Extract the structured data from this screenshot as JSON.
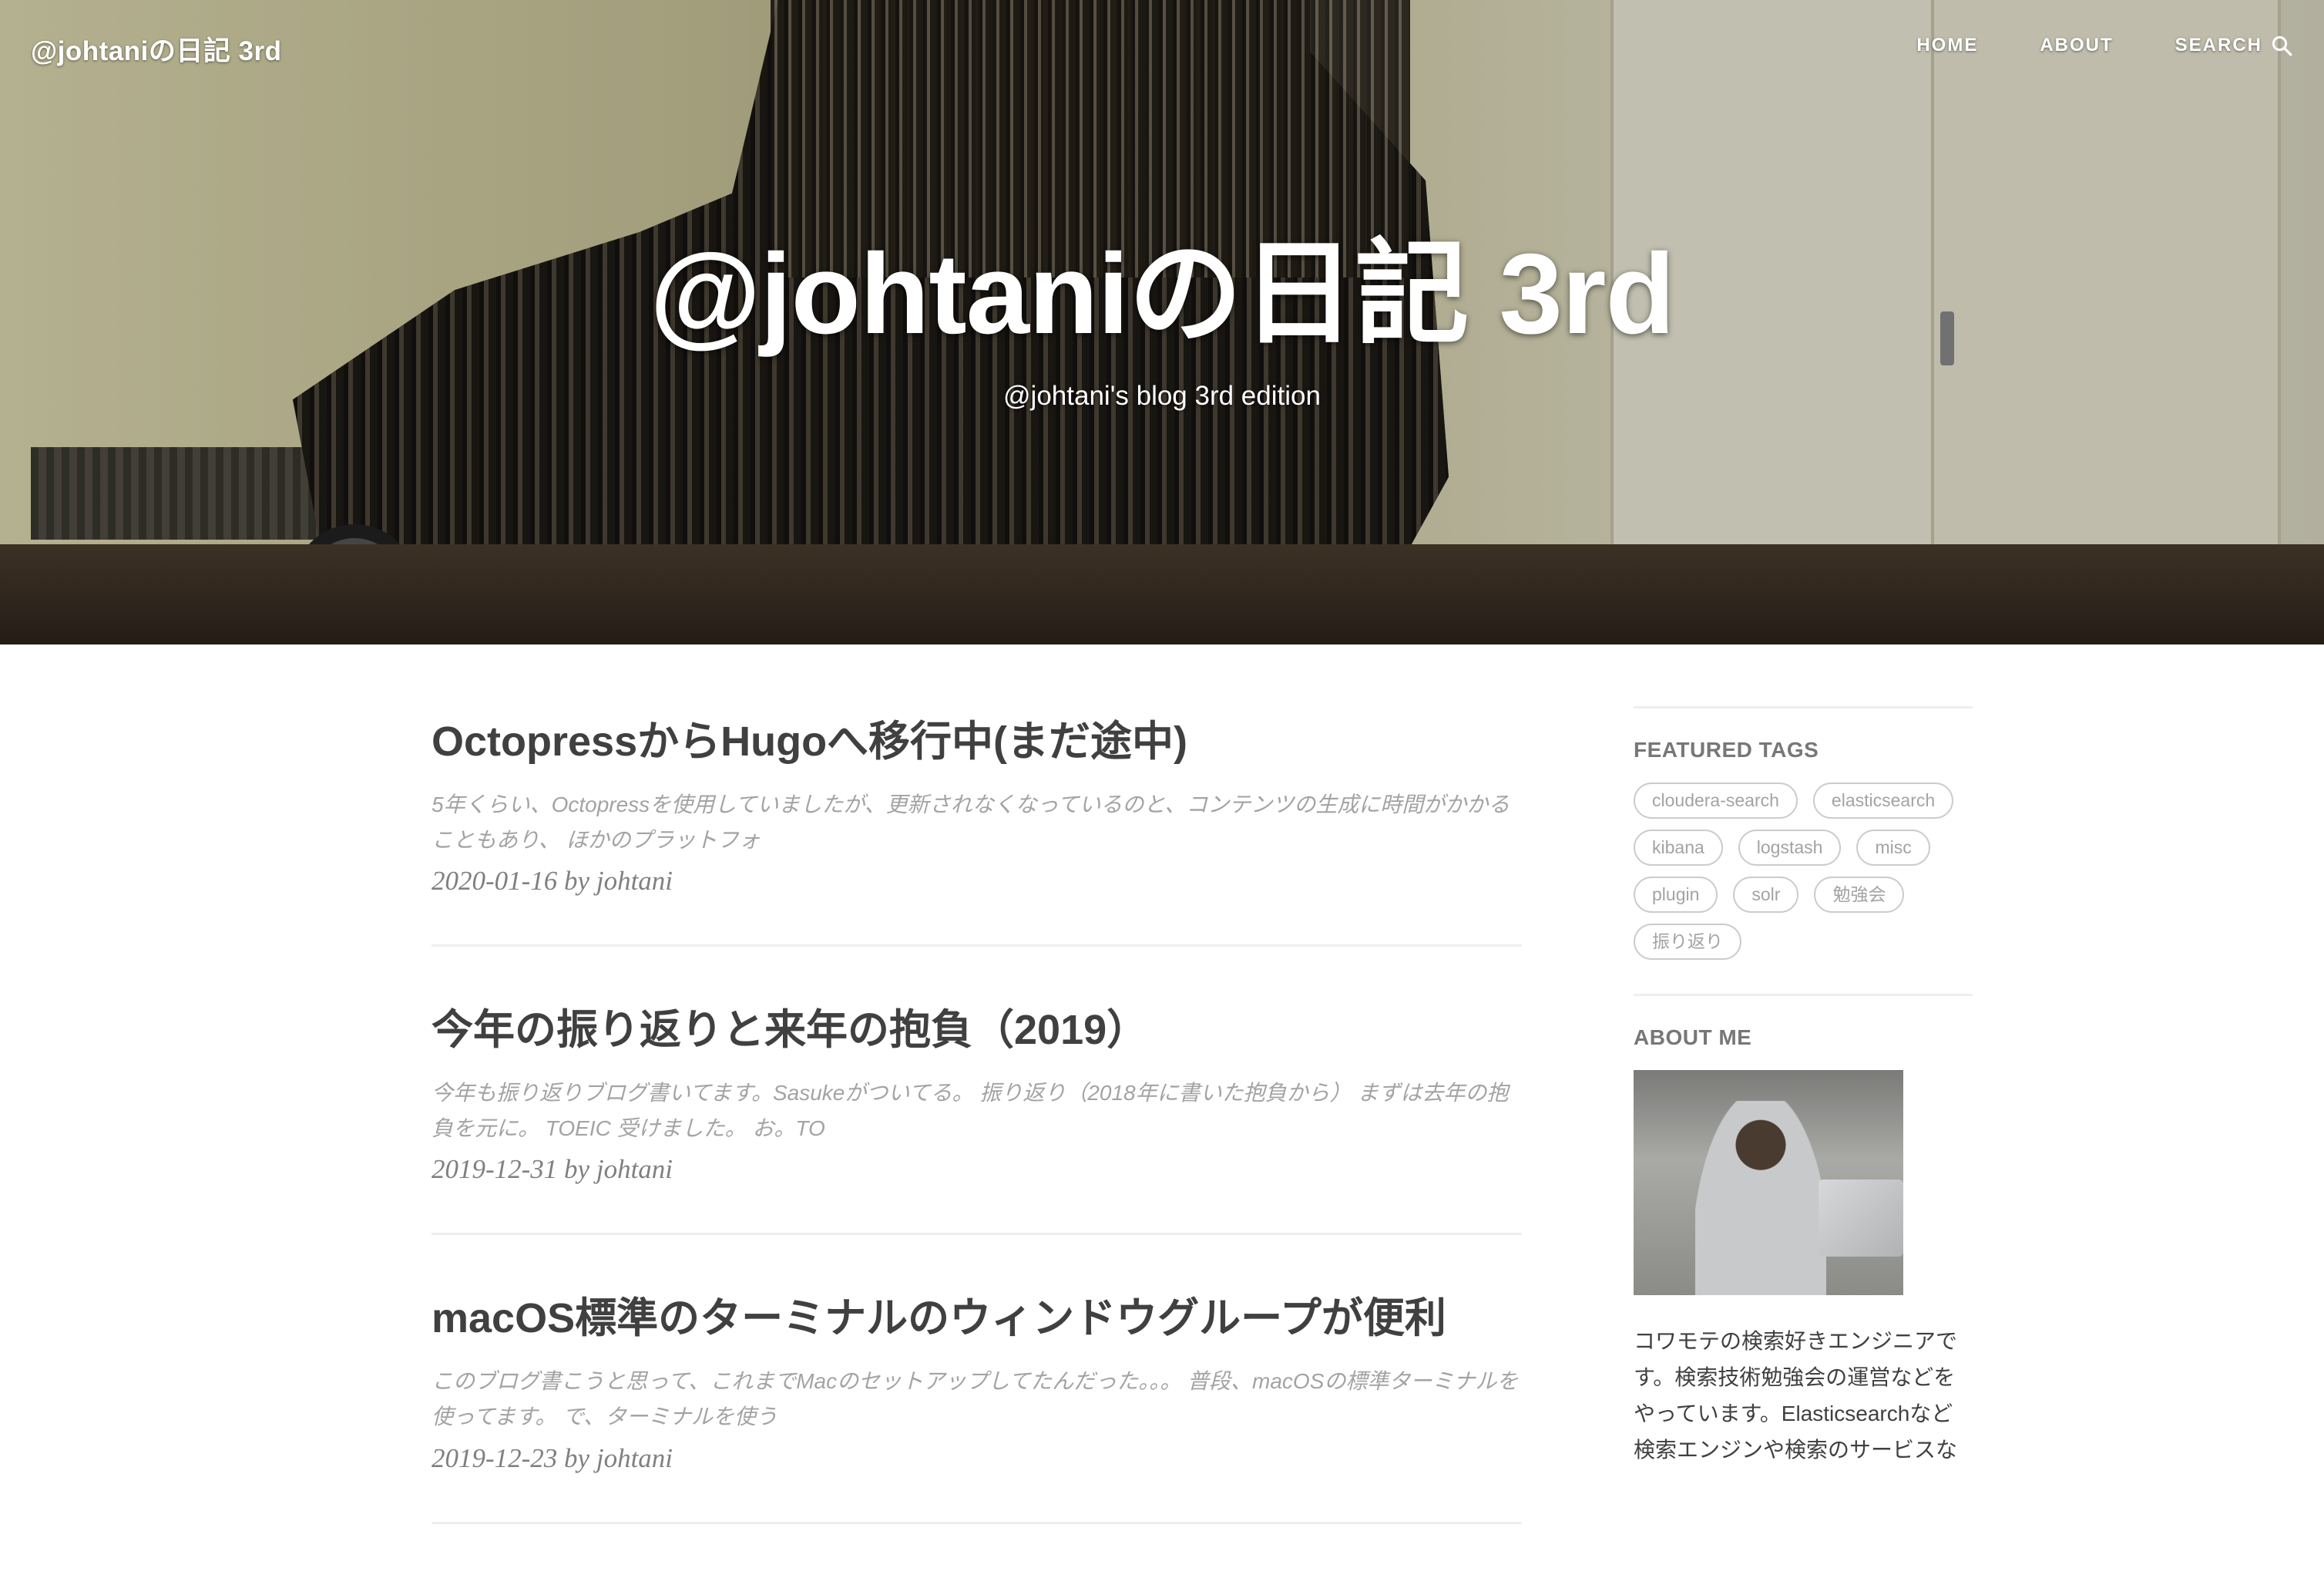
{
  "header": {
    "brand": "@johtaniの日記 3rd",
    "nav": [
      "HOME",
      "ABOUT",
      "SEARCH"
    ],
    "title": "@johtaniの日記 3rd",
    "subtitle": "@johtani's blog 3rd edition"
  },
  "posts": [
    {
      "title": "OctopressからHugoへ移行中(まだ途中)",
      "excerpt": "5年くらい、Octopressを使用していましたが、更新されなくなっているのと、コンテンツの生成に時間がかかることもあり、 ほかのプラットフォ",
      "meta": "2020-01-16 by johtani"
    },
    {
      "title": "今年の振り返りと来年の抱負（2019）",
      "excerpt": "今年も振り返りブログ書いてます。Sasukeがついてる。 振り返り（2018年に書いた抱負から） まずは去年の抱負を元に。 TOEIC 受けました。 お。TO",
      "meta": "2019-12-31 by johtani"
    },
    {
      "title": "macOS標準のターミナルのウィンドウグループが便利",
      "excerpt": "このブログ書こうと思って、これまでMacのセットアップしてたんだった。。。 普段、macOSの標準ターミナルを使ってます。 で、ターミナルを使う",
      "meta": "2019-12-23 by johtani"
    }
  ],
  "sidebar": {
    "featured_tags_heading": "FEATURED TAGS",
    "tags": [
      "cloudera-search",
      "elasticsearch",
      "kibana",
      "logstash",
      "misc",
      "plugin",
      "solr",
      "勉強会",
      "振り返り"
    ],
    "about_heading": "ABOUT ME",
    "about_text": "コワモテの検索好きエンジニアです。検索技術勉強会の運営などをやっています。Elasticsearchなど検索エンジンや検索のサービスな"
  },
  "icons": {
    "search": "search-icon"
  },
  "colors": {
    "text": "#404040",
    "muted": "#a3a3a3",
    "meta": "#808080",
    "sidebar_heading": "#777777"
  }
}
